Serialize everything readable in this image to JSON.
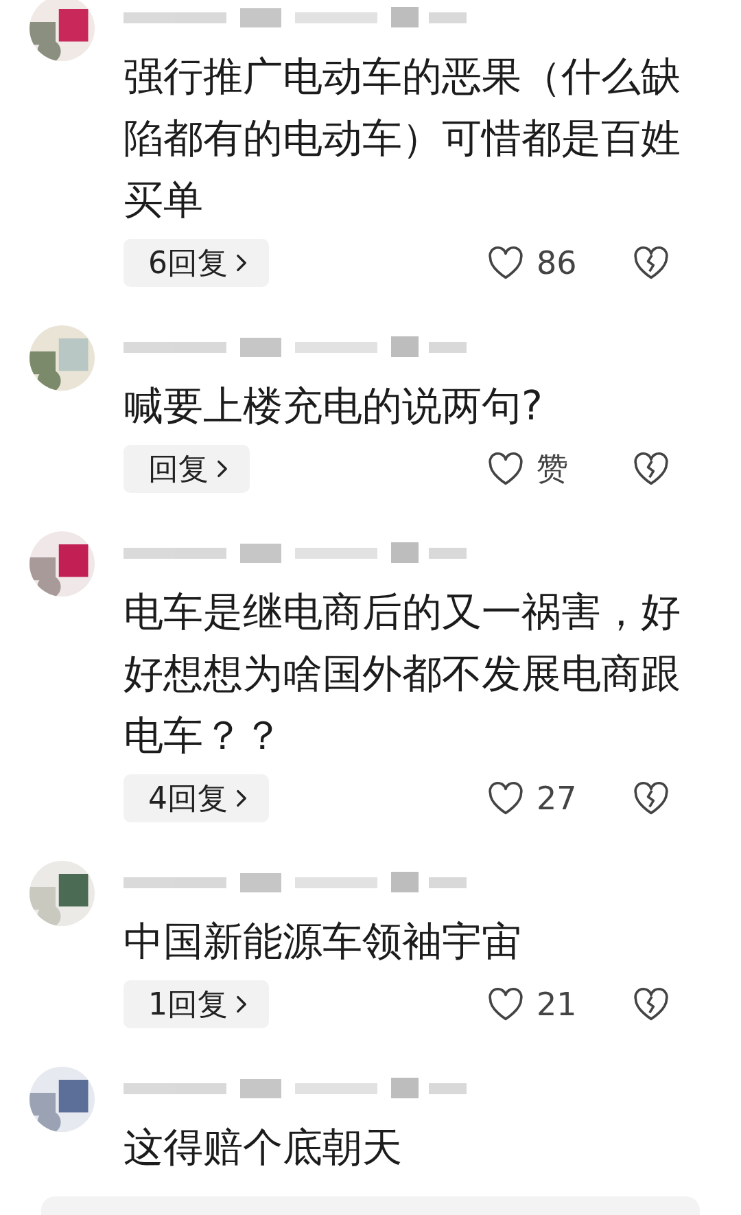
{
  "comments": [
    {
      "text": "强行推广电动车的恶果（什么缺陷都有的电动车）可惜都是百姓买单",
      "replies": "6回复",
      "likes": "86"
    },
    {
      "text": "喊要上楼充电的说两句?",
      "replies": "回复",
      "likes": "赞"
    },
    {
      "text": "电车是继电商后的又一祸害，好好想想为啥国外都不发展电商跟电车？？",
      "replies": "4回复",
      "likes": "27"
    },
    {
      "text": "中国新能源车领袖宇宙",
      "replies": "1回复",
      "likes": "21"
    },
    {
      "text": "这得赔个底朝天"
    }
  ]
}
